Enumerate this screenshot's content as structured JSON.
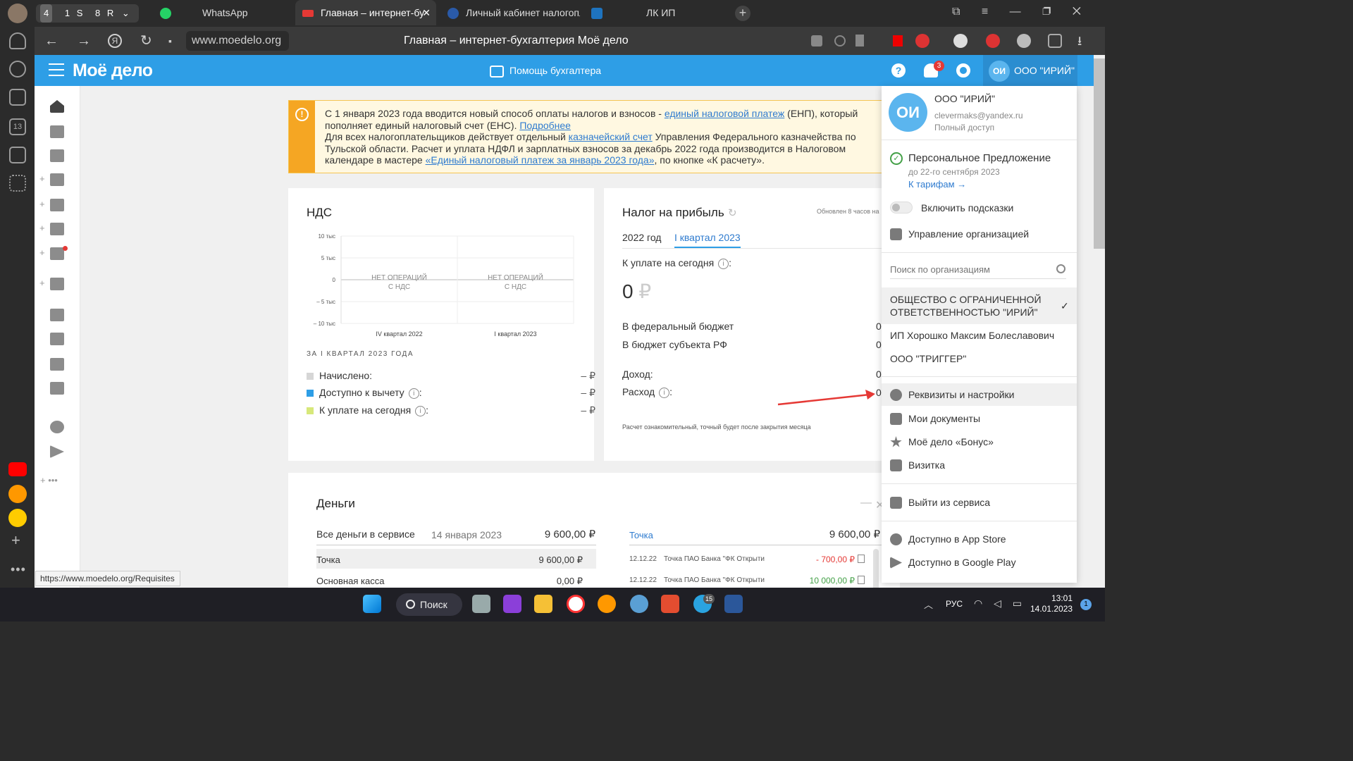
{
  "browser": {
    "tab_counters": [
      "4",
      "1",
      "S",
      "8",
      "R"
    ],
    "tabs": [
      {
        "label": "WhatsApp"
      },
      {
        "label": "Главная – интернет-бу"
      },
      {
        "label": "Личный кабинет налогопл"
      },
      {
        "label": "ЛК ИП"
      }
    ],
    "url": "www.moedelo.org",
    "page_title": "Главная – интернет-бухгалтерия Моё дело",
    "status_url": "https://www.moedelo.org/Requisites"
  },
  "app": {
    "logo": "Моё дело",
    "helper": "Помощь бухгалтера",
    "notifications_count": "3",
    "org_avatar": "ОИ",
    "org_name": "ООО \"ИРИЙ\""
  },
  "notice": {
    "text1": "С 1 января 2023 года вводится новый способ оплаты налогов и взносов - ",
    "link1": "единый налоговой платеж",
    "text2": " (ЕНП), который пополняет единый налоговый счет (ЕНС). ",
    "link2": "Подробнее",
    "text3": "Для всех налогоплательщиков действует отдельный ",
    "link3": "казначейский счет",
    "text4": " Управления Федерального казначейства по Тульской области. Расчет и уплата НДФЛ и зарплатных взносов за декабрь 2022 года производится в Налоговом календаре в мастере ",
    "link4": "«Единый налоговый платеж за январь 2023 года»",
    "text5": ", по кнопке «К расчету»."
  },
  "vat": {
    "title": "НДС",
    "chart_data": {
      "type": "bar",
      "categories": [
        "IV квартал 2022",
        "I квартал 2023"
      ],
      "y_ticks": [
        "10 тыс",
        "5 тыс",
        "0",
        "– 5 тыс",
        "– 10 тыс"
      ],
      "empty_label_1": "НЕТ ОПЕРАЦИЙ",
      "empty_label_2": "С НДС",
      "ylim": [
        -10000,
        10000
      ]
    },
    "period": "ЗА I КВАРТАЛ 2023 ГОДА",
    "rows": [
      {
        "label": "Начислено:",
        "value": "– ₽",
        "color": "#d6d6d6"
      },
      {
        "label": "Доступно к вычету",
        "value": "– ₽",
        "color": "#2e9ee6"
      },
      {
        "label": "К уплате на сегодня",
        "value": "– ₽",
        "color": "#d7e87a"
      }
    ]
  },
  "profit": {
    "title": "Налог на прибыль",
    "updated": "Обновлен 8 часов на",
    "tabs": [
      "2022 год",
      "I квартал 2023"
    ],
    "due_label": "К уплате на сегодня",
    "due_value": "0",
    "currency": "₽",
    "rows": [
      {
        "label": "В федеральный бюджет",
        "value": "0"
      },
      {
        "label": "В бюджет субъекта РФ",
        "value": "0"
      },
      {
        "label": "Доход:",
        "value": "0"
      },
      {
        "label": "Расход",
        "value": "0"
      }
    ],
    "note": "Расчет ознакомительный, точный будет после закрытия месяца"
  },
  "money": {
    "title": "Деньги",
    "all_label": "Все деньги в сервисе",
    "date": "14 января 2023",
    "total": "9 600,00 ₽",
    "accounts": [
      {
        "name": "Точка",
        "amount": "9 600,00 ₽"
      },
      {
        "name": "Основная касса",
        "amount": "0,00 ₽"
      }
    ],
    "right_account": "Точка",
    "right_total": "9 600,00 ₽",
    "ops": [
      {
        "date": "12.12.22",
        "desc": "Точка ПАО Банка \"ФК Открыти",
        "amount": "- 700,00 ₽",
        "color": "#e53935"
      },
      {
        "date": "12.12.22",
        "desc": "Точка ПАО Банка \"ФК Открыти",
        "amount": "10 000,00 ₽",
        "color": "#43a047"
      }
    ]
  },
  "dropdown": {
    "avatar": "ОИ",
    "org": "ООО \"ИРИЙ\"",
    "email": "clevermaks@yandex.ru",
    "access": "Полный доступ",
    "offer_title": "Персональное Предложение",
    "offer_date": "до 22-го сентября 2023",
    "offer_link": "К тарифам →",
    "hints": "Включить подсказки",
    "manage": "Управление организацией",
    "search_placeholder": "Поиск по организациям",
    "orgs": [
      {
        "name": "ОБЩЕСТВО С ОГРАНИЧЕННОЙ ОТВЕТСТВЕННОСТЬЮ \"ИРИЙ\""
      },
      {
        "name": "ИП Хорошко Максим Болеславович"
      },
      {
        "name": "ООО \"ТРИГГЕР\""
      }
    ],
    "menu": [
      "Реквизиты и настройки",
      "Мои документы",
      "Моё дело «Бонус»",
      "Визитка"
    ],
    "logout": "Выйти из сервиса",
    "appstore": "Доступно в App Store",
    "googleplay": "Доступно в Google Play"
  },
  "taskbar": {
    "search": "Поиск",
    "lang": "РУС",
    "time": "13:01",
    "date": "14.01.2023",
    "telegram_badge": "15",
    "notif": "1"
  }
}
